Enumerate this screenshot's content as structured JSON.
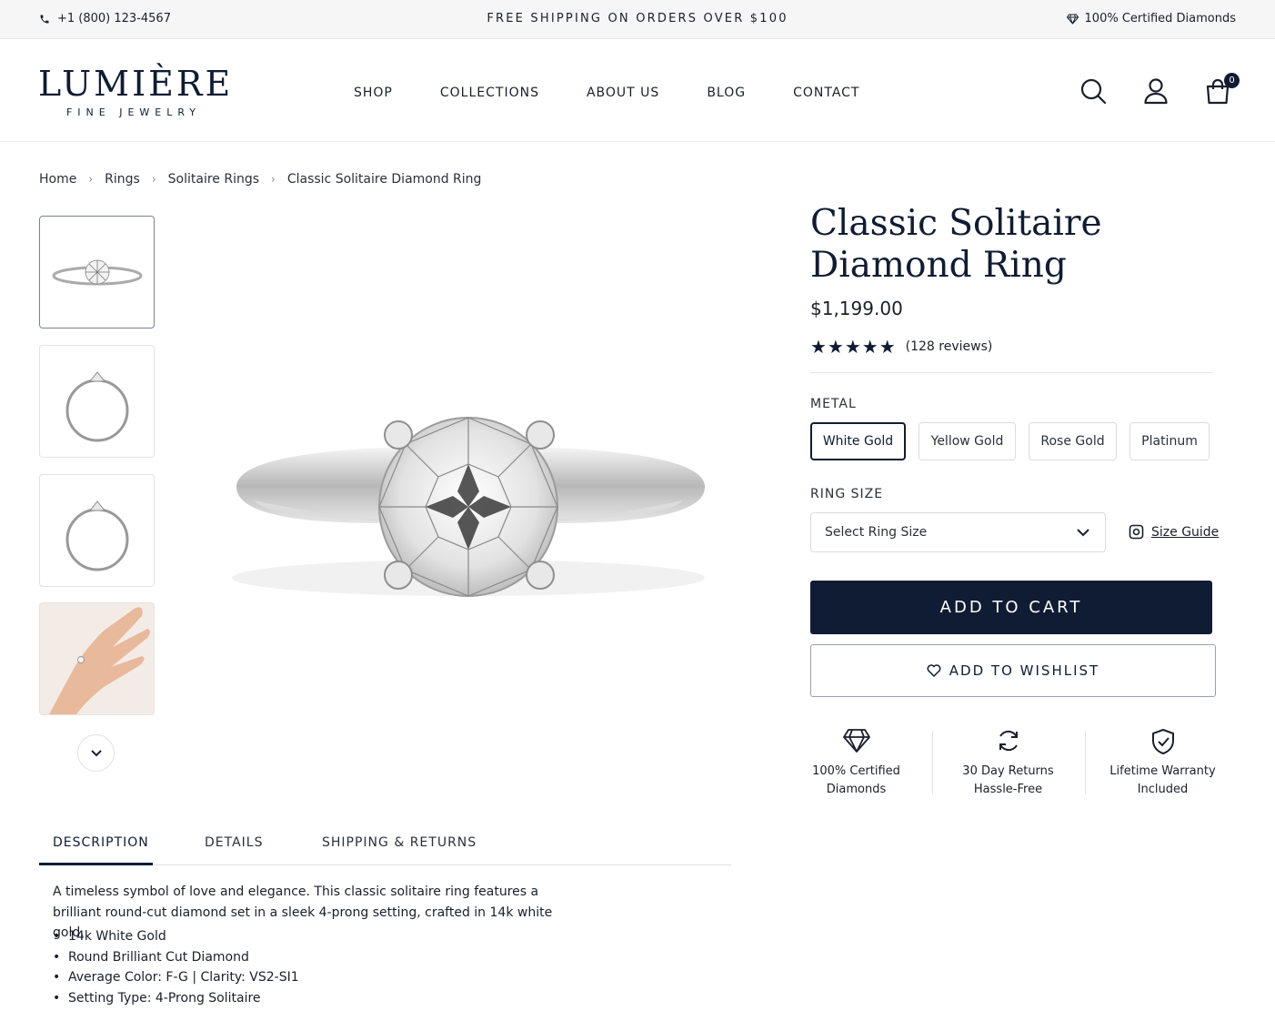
{
  "topbar": {
    "phone": "+1 (800) 123-4567",
    "promo": "FREE SHIPPING ON ORDERS OVER $100",
    "certified": "100% Certified Diamonds"
  },
  "header": {
    "logo_name": "LUMIÈRE",
    "logo_sub": "FINE JEWELRY",
    "nav": [
      "SHOP",
      "COLLECTIONS",
      "ABOUT US",
      "BLOG",
      "CONTACT"
    ],
    "cart_count": "0"
  },
  "breadcrumb": [
    "Home",
    "Rings",
    "Solitaire Rings",
    "Classic Solitaire Diamond Ring"
  ],
  "product": {
    "title": "Classic Solitaire Diamond Ring",
    "price": "$1,199.00",
    "rating": 5,
    "reviews": "(128 reviews)",
    "metal_label": "METAL",
    "metals": [
      "White Gold",
      "Yellow Gold",
      "Rose Gold",
      "Platinum"
    ],
    "metal_selected": "White Gold",
    "size_label": "RING SIZE",
    "size_placeholder": "Select Ring Size",
    "size_guide": "Size Guide",
    "add_to_cart": "ADD TO CART",
    "add_to_wishlist": "ADD TO WISHLIST"
  },
  "features": [
    {
      "icon": "diamond-icon",
      "line1": "100% Certified",
      "line2": "Diamonds"
    },
    {
      "icon": "returns-icon",
      "line1": "30 Day Returns",
      "line2": "Hassle-Free"
    },
    {
      "icon": "shield-check-icon",
      "line1": "Lifetime Warranty",
      "line2": "Included"
    }
  ],
  "tabs": [
    "DESCRIPTION",
    "DETAILS",
    "SHIPPING & RETURNS"
  ],
  "description": {
    "text": "A timeless symbol of love and elegance. This classic solitaire ring features a brilliant round-cut diamond set in a sleek 4-prong setting, crafted in 14k white gold.",
    "bullets": [
      "14k White Gold",
      "Round Brilliant Cut Diamond",
      "Average Color: F-G | Clarity: VS2-SI1",
      "Setting Type: 4-Prong Solitaire"
    ]
  },
  "colors": {
    "navy": "#0f1c33",
    "topbar_bg": "#f6f6f6"
  }
}
